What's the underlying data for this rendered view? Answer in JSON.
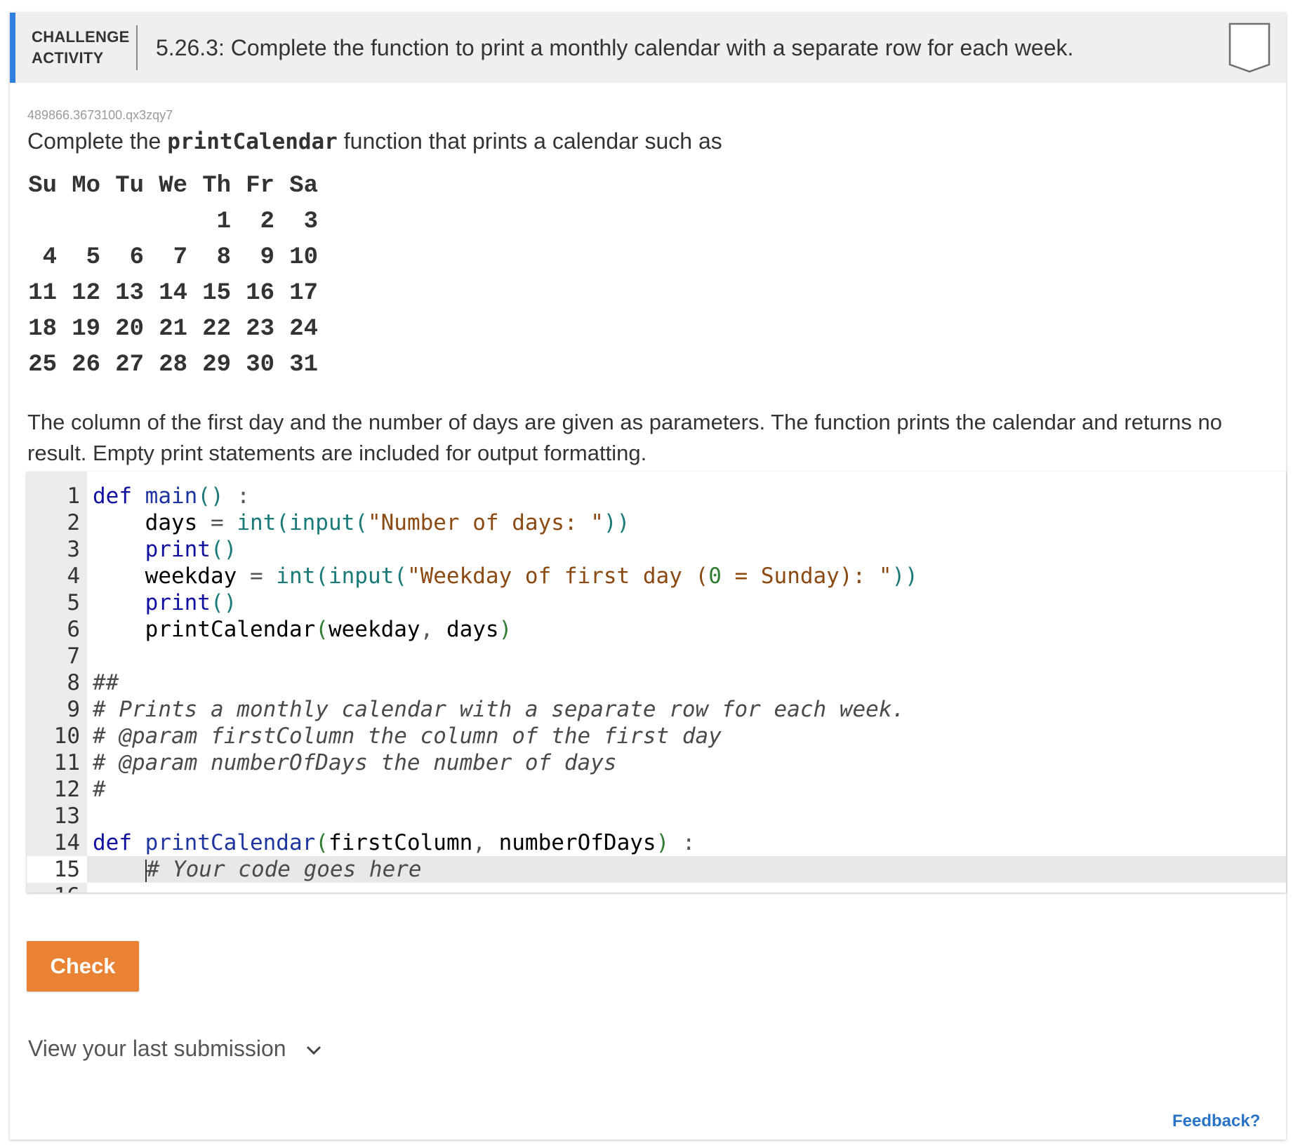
{
  "header": {
    "kind_line1": "CHALLENGE",
    "kind_line2": "ACTIVITY",
    "title": "5.26.3: Complete the function to print a monthly calendar with a separate row for each week."
  },
  "activity_id": "489866.3673100.qx3zqy7",
  "intro": {
    "before": "Complete the ",
    "code": "printCalendar",
    "after": " function that prints a calendar such as"
  },
  "calendar": {
    "header": [
      "Su",
      "Mo",
      "Tu",
      "We",
      "Th",
      "Fr",
      "Sa"
    ],
    "weeks": [
      [
        "",
        "",
        "",
        "",
        "1",
        "2",
        "3"
      ],
      [
        "4",
        "5",
        "6",
        "7",
        "8",
        "9",
        "10"
      ],
      [
        "11",
        "12",
        "13",
        "14",
        "15",
        "16",
        "17"
      ],
      [
        "18",
        "19",
        "20",
        "21",
        "22",
        "23",
        "24"
      ],
      [
        "25",
        "26",
        "27",
        "28",
        "29",
        "30",
        "31"
      ]
    ]
  },
  "description": "The column of the first day and the number of days are given as parameters. The function prints the calendar and returns no result. Empty print statements are included for output formatting.",
  "editor": {
    "active_line": 15,
    "lines": [
      [
        [
          "kw",
          "def "
        ],
        [
          "fn",
          "main"
        ],
        [
          "builtin",
          "()"
        ],
        [
          "op",
          " :"
        ]
      ],
      [
        [
          "",
          "    days "
        ],
        [
          "op",
          "= "
        ],
        [
          "builtin",
          "int(input("
        ],
        [
          "str",
          "\"Number of days: \""
        ],
        [
          "builtin",
          "))"
        ]
      ],
      [
        [
          "",
          "    "
        ],
        [
          "kw",
          "print"
        ],
        [
          "builtin",
          "()"
        ]
      ],
      [
        [
          "",
          "    weekday "
        ],
        [
          "op",
          "= "
        ],
        [
          "builtin",
          "int(input("
        ],
        [
          "str",
          "\"Weekday of first day ("
        ],
        [
          "num",
          "0"
        ],
        [
          "str",
          " = Sunday): \""
        ],
        [
          "builtin",
          "))"
        ]
      ],
      [
        [
          "",
          "    "
        ],
        [
          "kw",
          "print"
        ],
        [
          "builtin",
          "()"
        ]
      ],
      [
        [
          "",
          "    printCalendar"
        ],
        [
          "num",
          "("
        ],
        [
          "",
          "weekday"
        ],
        [
          "op",
          ", "
        ],
        [
          "",
          "days"
        ],
        [
          "num",
          ")"
        ]
      ],
      [],
      [
        [
          "cm",
          "##"
        ]
      ],
      [
        [
          "cm",
          "# Prints a monthly calendar with a separate row for each week."
        ]
      ],
      [
        [
          "cm",
          "# @param firstColumn the column of the first day"
        ]
      ],
      [
        [
          "cm",
          "# @param numberOfDays the number of days"
        ]
      ],
      [
        [
          "cm",
          "#"
        ]
      ],
      [],
      [
        [
          "kw",
          "def "
        ],
        [
          "fn",
          "printCalendar"
        ],
        [
          "num",
          "("
        ],
        [
          "",
          "firstColumn"
        ],
        [
          "op",
          ", "
        ],
        [
          "",
          "numberOfDays"
        ],
        [
          "num",
          ")"
        ],
        [
          "op",
          " :"
        ]
      ],
      [
        [
          "",
          "    "
        ],
        [
          "cursor",
          ""
        ],
        [
          "cm",
          "# Your code goes here"
        ]
      ],
      []
    ]
  },
  "check_label": "Check",
  "last_submission_label": "View your last submission",
  "feedback_label": "Feedback?",
  "colors": {
    "accent": "#2f7fe0",
    "check_button": "#e98233",
    "feedback_link": "#2a74c8"
  }
}
